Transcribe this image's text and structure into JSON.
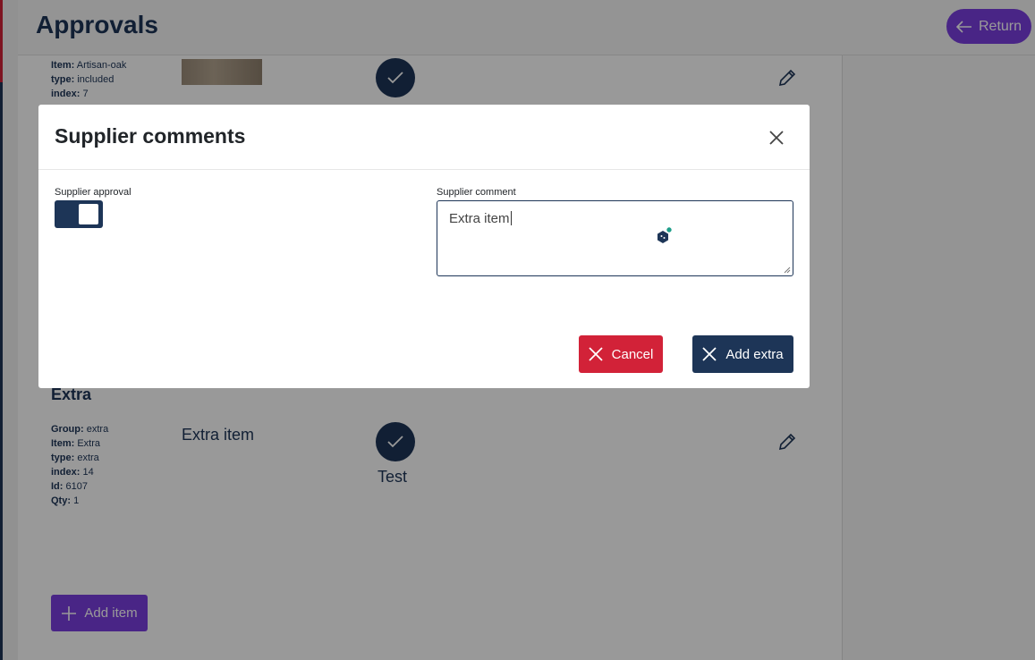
{
  "header": {
    "title": "Approvals",
    "return_label": "Return"
  },
  "items": [
    {
      "meta": [
        {
          "key": "Item:",
          "value": "Artisan-oak"
        },
        {
          "key": "type:",
          "value": "included"
        },
        {
          "key": "index:",
          "value": "7"
        }
      ]
    }
  ],
  "extra_section": {
    "title": "Extra",
    "meta": [
      {
        "key": "Group:",
        "value": "extra"
      },
      {
        "key": "Item:",
        "value": "Extra"
      },
      {
        "key": "type:",
        "value": "extra"
      },
      {
        "key": "index:",
        "value": "14"
      },
      {
        "key": "Id:",
        "value": "6107"
      },
      {
        "key": "Qty:",
        "value": "1"
      }
    ],
    "item_name": "Extra item",
    "status_text": "Test"
  },
  "add_item_label": "Add item",
  "modal": {
    "title": "Supplier comments",
    "approval_label": "Supplier approval",
    "approval_on": true,
    "comment_label": "Supplier comment",
    "comment_value": "Extra item",
    "cancel_label": "Cancel",
    "add_extra_label": "Add extra"
  },
  "colors": {
    "navy": "#1d3557",
    "purple": "#7b3fe0",
    "red": "#d22238"
  },
  "icons": [
    "arrow-left-icon",
    "check-icon",
    "pencil-icon",
    "plus-icon",
    "close-icon",
    "grammar-assistant-icon"
  ]
}
